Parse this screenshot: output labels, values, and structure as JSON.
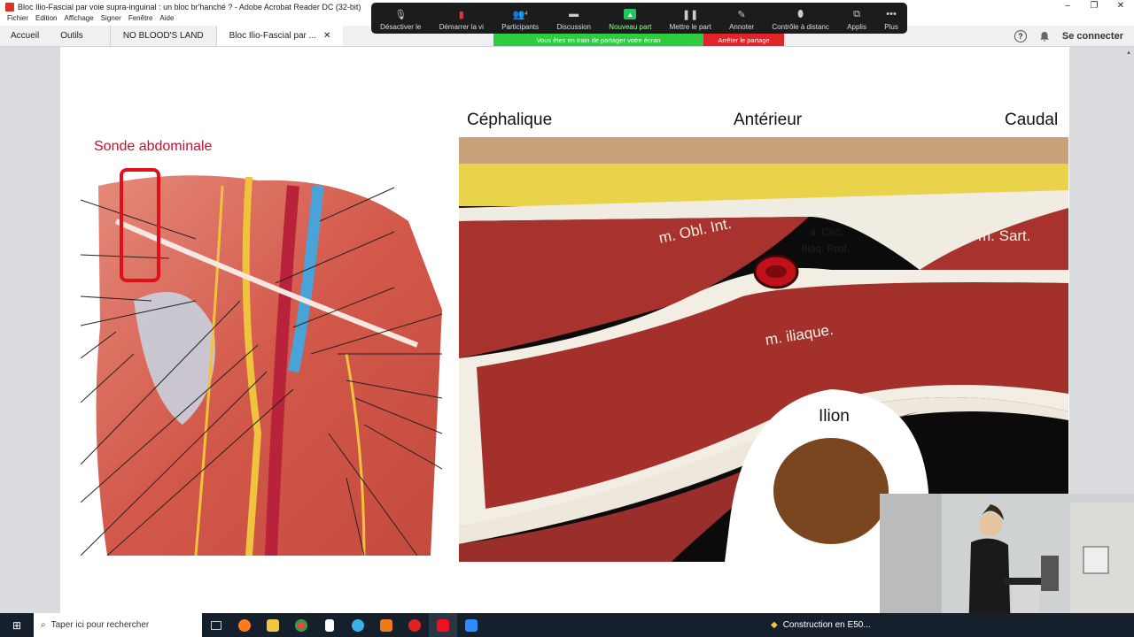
{
  "window": {
    "title": "Bloc Ilio-Fascial par voie supra-inguinal : un bloc br'hanché ? - Adobe Acrobat Reader DC (32-bit)"
  },
  "menu": [
    "Fichier",
    "Edition",
    "Affichage",
    "Signer",
    "Fenêtre",
    "Aide"
  ],
  "tabs": {
    "home": "Accueil",
    "tools": "Outils",
    "doc1": "NO BLOOD'S LAND",
    "doc2": "Bloc Ilio-Fascial par ...",
    "signin": "Se connecter"
  },
  "share_toolbar": {
    "items": [
      {
        "label": "Désactiver le",
        "icon": "mic-icon"
      },
      {
        "label": "Démarrer la vi",
        "icon": "video-off-icon"
      },
      {
        "label": "Participants",
        "icon": "participants-icon",
        "count": "4"
      },
      {
        "label": "Discussion",
        "icon": "chat-icon"
      },
      {
        "label": "Nouveau part",
        "icon": "share-up-icon"
      },
      {
        "label": "Mettre le part",
        "icon": "pause-icon"
      },
      {
        "label": "Annoter",
        "icon": "pen-icon"
      },
      {
        "label": "Contrôle à distanc",
        "icon": "mouse-icon"
      },
      {
        "label": "Applis",
        "icon": "apps-icon"
      },
      {
        "label": "Plus",
        "icon": "more-icon"
      }
    ],
    "status": "Vous êtes en train de partager votre écran",
    "stop": "Arrêter le partage"
  },
  "slide": {
    "probe_label": "Sonde abdominale",
    "orientation": {
      "left": "Céphalique",
      "center": "Antérieur",
      "right": "Caudal"
    },
    "us_labels": {
      "obl": "m. Obl. Int.",
      "circ1": "a. Circ.",
      "circ2": "Iliaq. Prof.",
      "sart": "m. Sart.",
      "iliac": "m. iliaque.",
      "ilion": "Ilion"
    }
  },
  "taskbar": {
    "search_placeholder": "Taper ici pour rechercher",
    "notification": "Construction en E50..."
  }
}
